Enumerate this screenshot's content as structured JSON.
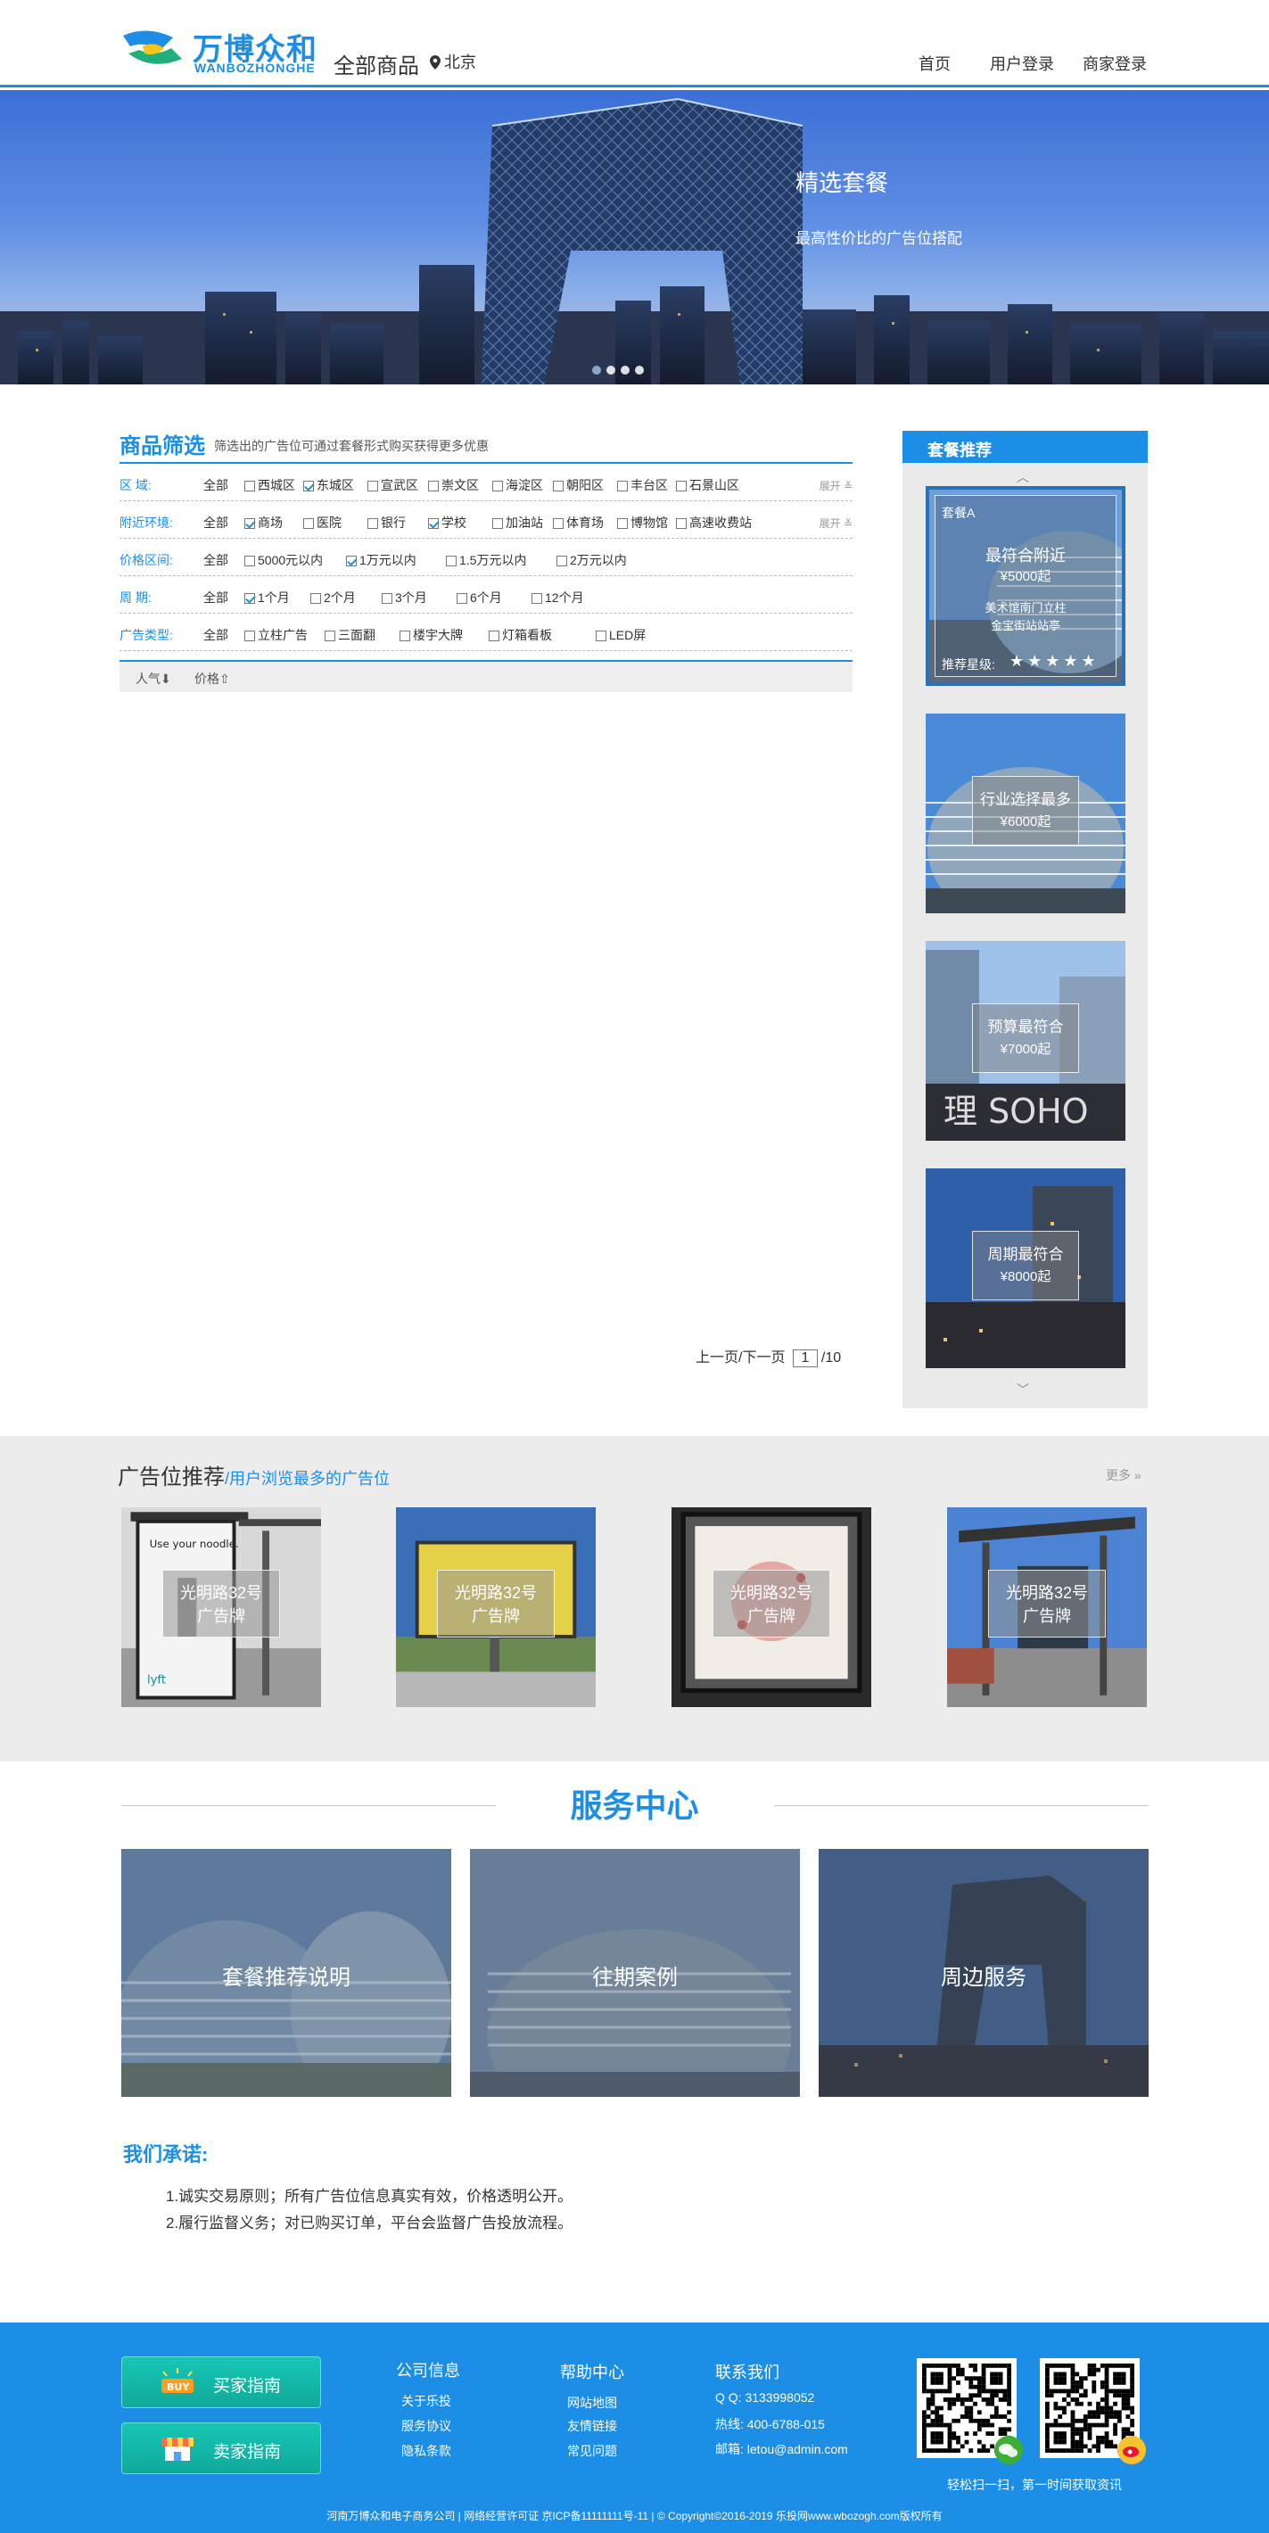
{
  "header": {
    "logo_cn": "万博众和",
    "logo_en": "WANBOZHONGHE",
    "all_goods": "全部商品",
    "city": "北京",
    "nav": [
      "首页",
      "用户登录",
      "商家登录"
    ]
  },
  "banner": {
    "title": "精选套餐",
    "subtitle": "最高性价比的广告位搭配"
  },
  "filter": {
    "title": "商品筛选",
    "desc": "筛选出的广告位可通过套餐形式购买获得更多优惠",
    "more": "展开",
    "rows": [
      {
        "label": "区    域:",
        "all": "全部",
        "options": [
          {
            "text": "西城区",
            "checked": false
          },
          {
            "text": "东城区",
            "checked": true
          },
          {
            "text": "宣武区",
            "checked": false
          },
          {
            "text": "崇文区",
            "checked": false
          },
          {
            "text": "海淀区",
            "checked": false
          },
          {
            "text": "朝阳区",
            "checked": false
          },
          {
            "text": "丰台区",
            "checked": false
          },
          {
            "text": "石景山区",
            "checked": false
          }
        ]
      },
      {
        "label": "附近环境:",
        "all": "全部",
        "options": [
          {
            "text": "商场",
            "checked": true
          },
          {
            "text": "医院",
            "checked": false
          },
          {
            "text": "银行",
            "checked": false
          },
          {
            "text": "学校",
            "checked": true
          },
          {
            "text": "加油站",
            "checked": false
          },
          {
            "text": "体育场",
            "checked": false
          },
          {
            "text": "博物馆",
            "checked": false
          },
          {
            "text": "高速收费站",
            "checked": false
          }
        ]
      },
      {
        "label": "价格区间:",
        "all": "全部",
        "options": [
          {
            "text": "5000元以内",
            "checked": false
          },
          {
            "text": "1万元以内",
            "checked": true
          },
          {
            "text": "1.5万元以内",
            "checked": false
          },
          {
            "text": "2万元以内",
            "checked": false
          }
        ]
      },
      {
        "label": "周    期:",
        "all": "全部",
        "options": [
          {
            "text": "1个月",
            "checked": true
          },
          {
            "text": "2个月",
            "checked": false
          },
          {
            "text": "3个月",
            "checked": false
          },
          {
            "text": "6个月",
            "checked": false
          },
          {
            "text": "12个月",
            "checked": false
          }
        ]
      },
      {
        "label": "广告类型:",
        "all": "全部",
        "options": [
          {
            "text": "立柱广告",
            "checked": false
          },
          {
            "text": "三面翻",
            "checked": false
          },
          {
            "text": "楼宇大牌",
            "checked": false
          },
          {
            "text": "灯箱看板",
            "checked": false
          },
          {
            "text": "LED屏",
            "checked": false
          }
        ]
      }
    ],
    "sort": [
      "人气⬇",
      "价格⇧"
    ]
  },
  "product": {
    "line1": "光明路32号",
    "line2": "广告牌"
  },
  "pager": {
    "prev_next": "上一页/下一页",
    "current": "1",
    "total": "/10"
  },
  "side": {
    "title": "套餐推荐",
    "packages": [
      {
        "tag": "套餐A",
        "name": "最符合附近",
        "price": "¥5000起",
        "desc1": "美术馆南门立柱",
        "desc2": "金宝街站站亭",
        "rating_label": "推荐星级:",
        "stars": 5
      },
      {
        "name": "行业选择最多",
        "price": "¥6000起"
      },
      {
        "name": "预算最符合",
        "price": "¥7000起"
      },
      {
        "name": "周期最符合",
        "price": "¥8000起"
      }
    ]
  },
  "recommend": {
    "title": "广告位推荐",
    "subtitle": "用户浏览最多的广告位",
    "more": "更多",
    "line1": "光明路32号",
    "line2": "广告牌"
  },
  "service": {
    "title": "服务中心",
    "items": [
      "套餐推荐说明",
      "往期案例",
      "周边服务"
    ]
  },
  "promise": {
    "title": "我们承诺:",
    "items": [
      "1.诚实交易原则；所有广告位信息真实有效，价格透明公开。",
      "2.履行监督义务；对已购买订单，平台会监督广告投放流程。"
    ]
  },
  "footer": {
    "buy_guide": "买家指南",
    "sell_guide": "卖家指南",
    "company": {
      "title": "公司信息",
      "links": [
        "关于乐投",
        "服务协议",
        "隐私条款"
      ]
    },
    "help": {
      "title": "帮助中心",
      "links": [
        "网站地图",
        "友情链接",
        "常见问题"
      ]
    },
    "contact": {
      "title": "联系我们",
      "lines": [
        "Q Q:  3133998052",
        "热线:  400-6788-015",
        "邮箱:  letou@admin.com"
      ]
    },
    "scan": "轻松扫一扫，第一时间获取资讯",
    "copyright": "河南万博众和电子商务公司 | 网络经营许可证 京ICP备11111111号-11 | © Copyright©2016-2019  乐投网www.wbozogh.com版权所有"
  },
  "colors": {
    "brand": "#1c8ee6",
    "footer": "#1c8ee6",
    "guide_button": "#10a99b"
  }
}
